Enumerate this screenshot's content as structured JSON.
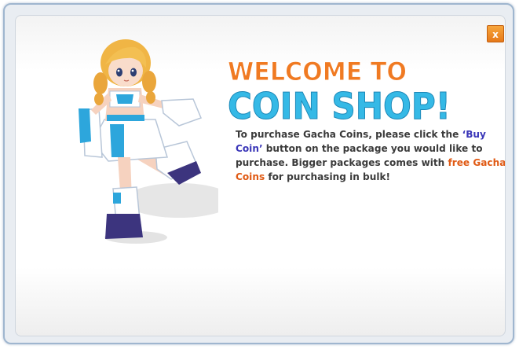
{
  "dialog": {
    "close_label": "x",
    "title_line1": "WELCOME TO",
    "title_line2": "COIN SHOP!",
    "body": {
      "part1": "To purchase Gacha Coins, please click the ",
      "link1": "‘Buy Coin’",
      "part2": " button on the package you would like to purchase. Bigger packages comes with ",
      "link2": "free Gacha Coins",
      "part3": " for purchasing in bulk!"
    }
  },
  "colors": {
    "title_orange": "#f07a22",
    "title_blue": "#35b9e6",
    "highlight_blue": "#3a36b8",
    "highlight_orange": "#e05a14",
    "close_button": "#ef8d28"
  },
  "icons": {
    "close": "close-icon",
    "character": "anime-girl-character"
  }
}
